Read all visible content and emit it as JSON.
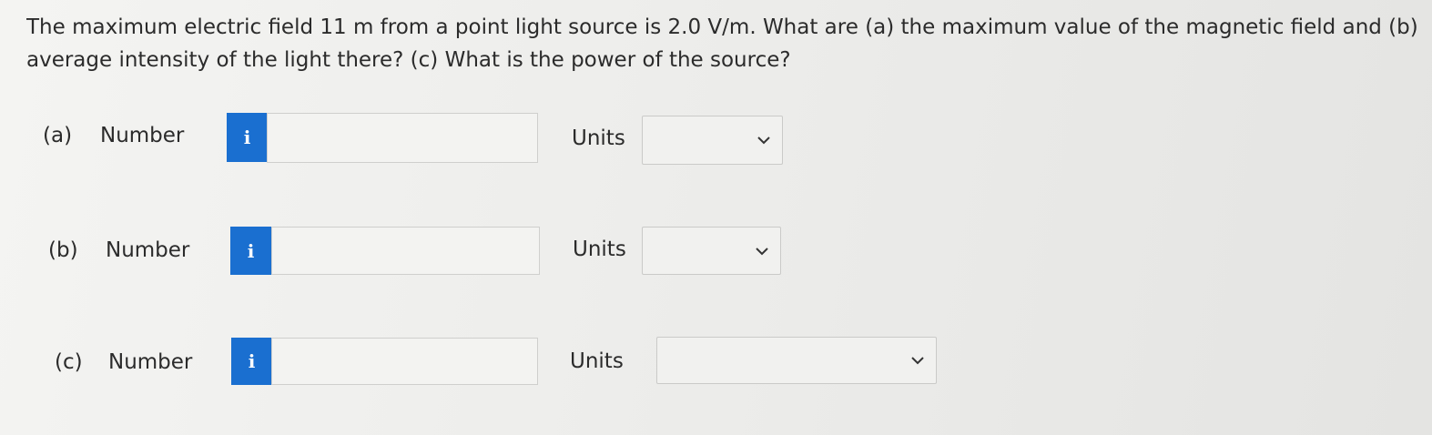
{
  "question": {
    "line1": "The maximum electric field 11 m from a point light source is 2.0 V/m. What are (a) the maximum value of the magnetic field and (b) th",
    "line2": "average intensity of the light there? (c) What is the power of the source?"
  },
  "parts": [
    {
      "label": "(a)",
      "number_label": "Number",
      "info_icon": "i",
      "number_value": "",
      "units_label": "Units",
      "units_value": ""
    },
    {
      "label": "(b)",
      "number_label": "Number",
      "info_icon": "i",
      "number_value": "",
      "units_label": "Units",
      "units_value": ""
    },
    {
      "label": "(c)",
      "number_label": "Number",
      "info_icon": "i",
      "number_value": "",
      "units_label": "Units",
      "units_value": ""
    }
  ],
  "icons": {
    "info": "info-icon",
    "dropdown": "chevron-down-icon"
  },
  "colors": {
    "info_button": "#1a6fd0"
  }
}
